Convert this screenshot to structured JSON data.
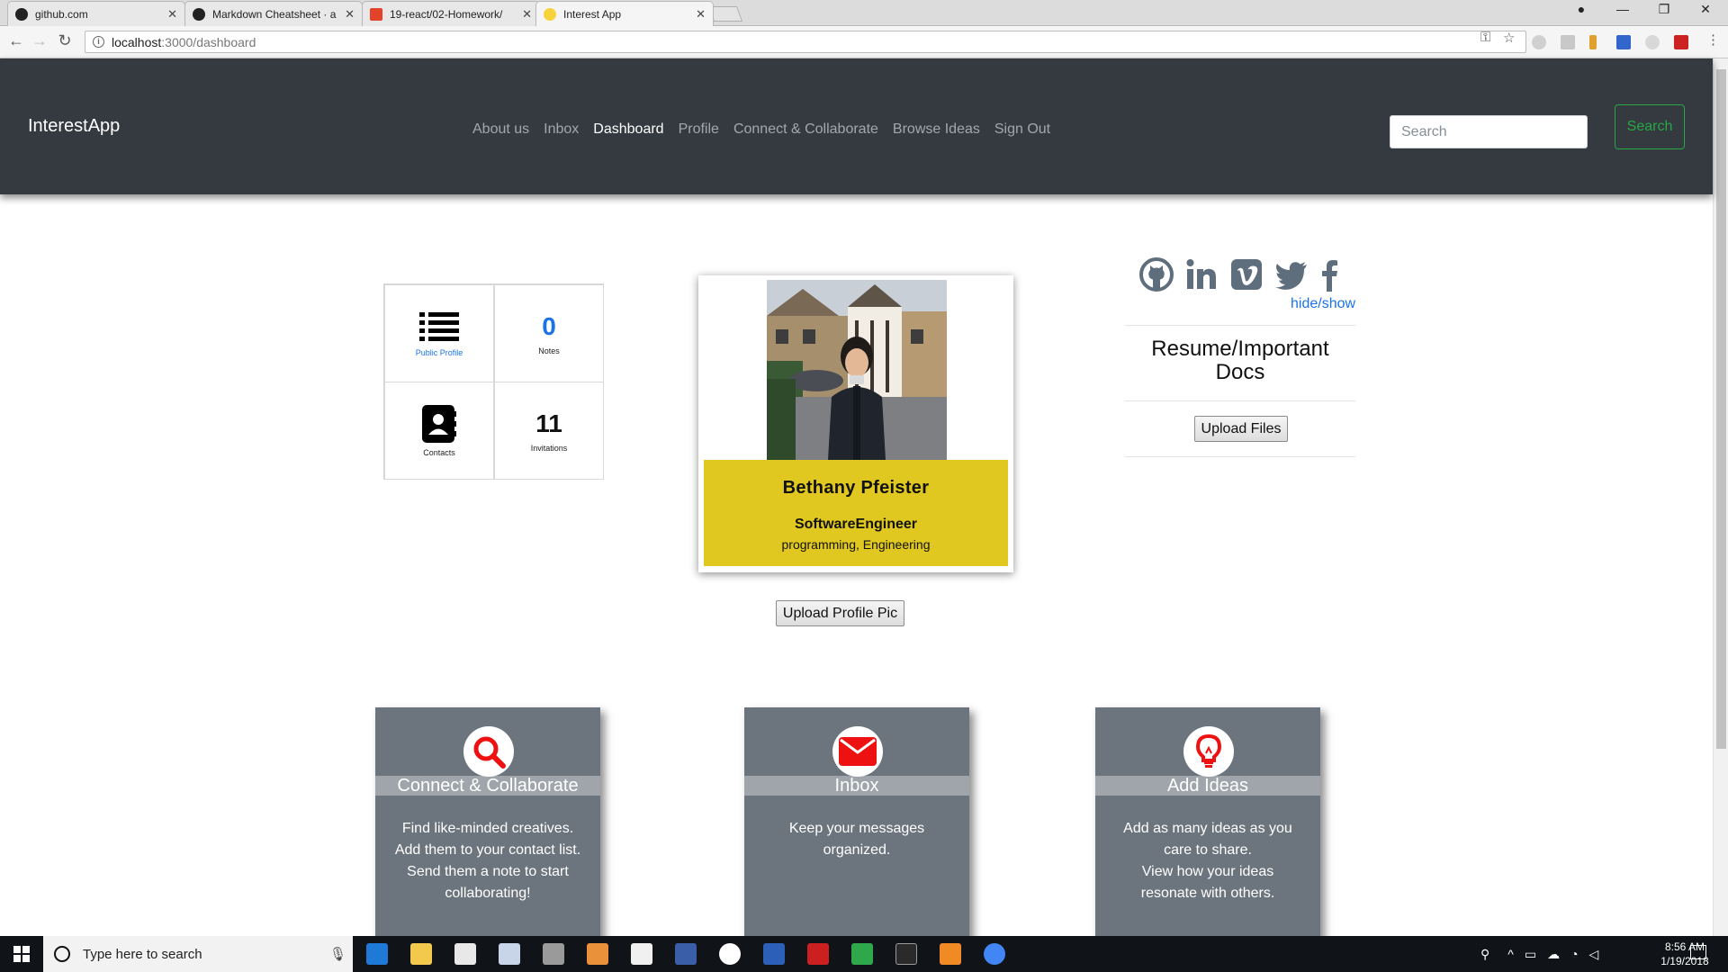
{
  "browser": {
    "tabs": [
      {
        "title": "github.com",
        "favicon": "github-icon",
        "close": "✕"
      },
      {
        "title": "Markdown Cheatsheet · a",
        "favicon": "github-icon",
        "close": "✕"
      },
      {
        "title": "19-react/02-Homework/",
        "favicon": "gitlab-icon",
        "close": "✕"
      },
      {
        "title": "Interest App",
        "favicon": "bulb-icon",
        "close": "✕"
      }
    ],
    "url_host": "localhost",
    "url_path": ":3000/dashboard"
  },
  "navbar": {
    "brand": "InterestApp",
    "links": [
      "About us",
      "Inbox",
      "Dashboard",
      "Profile",
      "Connect & Collaborate",
      "Browse Ideas",
      "Sign Out"
    ],
    "active_link": "Dashboard",
    "search_placeholder": "Search",
    "search_button": "Search",
    "colors": {
      "bg": "#343a40",
      "search_btn": "#28a745"
    }
  },
  "stats": {
    "public_profile_label": "Public Profile",
    "notes_count": "0",
    "notes_label": "Notes",
    "contacts_label": "Contacts",
    "invitations_count": "11",
    "invitations_label": "Invitations",
    "colors": {
      "notes_count": "#1a73e8",
      "public_profile_label": "#1a73e8"
    }
  },
  "profile": {
    "name": "Bethany Pfeister",
    "title": "SoftwareEngineer",
    "interests": "programming, Engineering",
    "upload_button": "Upload Profile Pic",
    "colors": {
      "info_bg": "#e0c820"
    }
  },
  "social": {
    "icons": [
      "github-icon",
      "linkedin-icon",
      "vimeo-icon",
      "twitter-icon",
      "facebook-icon"
    ],
    "hide_show": "hide/show"
  },
  "docs": {
    "title": "Resume/Important Docs",
    "upload_button": "Upload Files"
  },
  "features": [
    {
      "title": "Connect & Collaborate",
      "icon": "search-icon",
      "lines": [
        "Find like-minded creatives.",
        "Add them to your contact list.",
        "Send them a note to start",
        "collaborating!"
      ]
    },
    {
      "title": "Inbox",
      "icon": "envelope-icon",
      "lines": [
        "Keep your messages",
        "organized."
      ]
    },
    {
      "title": "Add Ideas",
      "icon": "lightbulb-icon",
      "lines": [
        "Add as many ideas as you",
        "care to share.",
        "View how your ideas",
        "resonate with others."
      ]
    }
  ],
  "taskbar": {
    "search_placeholder": "Type here to search",
    "time": "8:56 AM",
    "date": "1/19/2018"
  }
}
